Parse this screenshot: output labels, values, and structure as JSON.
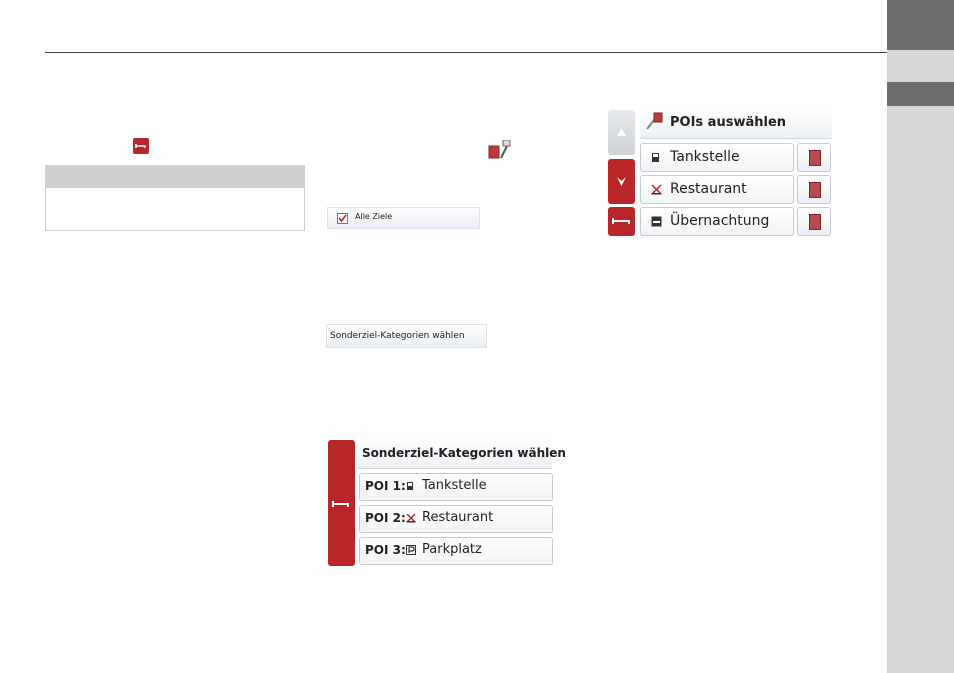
{
  "side_tabs": {
    "color_dark": "#6b6b6b",
    "color_light": "#d7d7d7"
  },
  "accent_color": "#b8262a",
  "icons": [
    "back-arrow-icon",
    "poi-select-icon",
    "checkbox-checked-icon",
    "up-arrow-icon",
    "down-arrow-icon",
    "fuel-icon",
    "restaurant-icon",
    "hotel-icon",
    "parking-icon",
    "book-icon"
  ],
  "alle_ziele": {
    "label": "Alle Ziele",
    "checked": true
  },
  "sonderziel_strip": {
    "label": "Sonderziel-Kategorien wählen"
  },
  "sonderziel_panel": {
    "title": "Sonderziel-Kategorien wählen",
    "rows": [
      {
        "num": "POI 1:",
        "icon": "fuel-icon",
        "label": "Tankstelle"
      },
      {
        "num": "POI 2:",
        "icon": "restaurant-icon",
        "label": "Restaurant"
      },
      {
        "num": "POI 3:",
        "icon": "parking-icon",
        "label": "Parkplatz"
      }
    ]
  },
  "pois_panel": {
    "title": "POIs auswählen",
    "rows": [
      {
        "icon": "fuel-icon",
        "label": "Tankstelle"
      },
      {
        "icon": "restaurant-icon",
        "label": "Restaurant"
      },
      {
        "icon": "hotel-icon",
        "label": "Übernachtung"
      }
    ]
  }
}
